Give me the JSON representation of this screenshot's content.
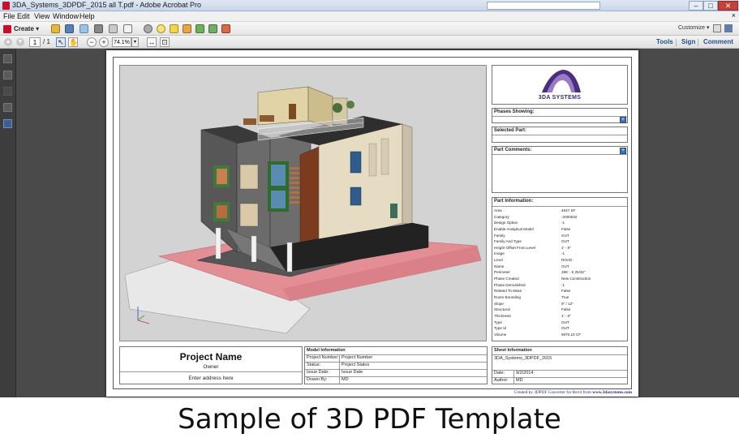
{
  "window": {
    "title": "3DA_Systems_3DPDF_2015 all T.pdf - Adobe Acrobat Pro",
    "buttons": {
      "minimize": "–",
      "maximize": "□",
      "close": "✕"
    }
  },
  "menu": {
    "items": [
      "File",
      "Edit",
      "View",
      "Window",
      "Help"
    ],
    "close_doc": "×"
  },
  "toolbar": {
    "create_label": "Create",
    "customize_label": "Customize"
  },
  "navigation": {
    "current_page": "1",
    "total_pages": "/ 1",
    "zoom": "74.1%",
    "panes": [
      "Tools",
      "Sign",
      "Comment"
    ]
  },
  "document": {
    "logo_text": "3DA SYSTEMS",
    "phases_label": "Phases Showing:",
    "selected_label": "Selected Part:",
    "comments_label": "Part Comments:",
    "info_label": "Part Information:",
    "part_info": [
      {
        "k": "Area",
        "v": "4647 SF"
      },
      {
        "k": "Category",
        "v": "-2000032"
      },
      {
        "k": "Design Option",
        "v": "-1"
      },
      {
        "k": "Enable Analytical Model",
        "v": "False"
      },
      {
        "k": "Family",
        "v": "OUT"
      },
      {
        "k": "Family And Type",
        "v": "OUT"
      },
      {
        "k": "Height Offset From Level",
        "v": "1' - 8\""
      },
      {
        "k": "Image",
        "v": "-1"
      },
      {
        "k": "Level",
        "v": "ROAD"
      },
      {
        "k": "Name",
        "v": "OUT"
      },
      {
        "k": "Perimeter",
        "v": "286' - 5 25/32\""
      },
      {
        "k": "Phase Created",
        "v": "New Construction"
      },
      {
        "k": "Phase Demolished",
        "v": "-1"
      },
      {
        "k": "Related To Mass",
        "v": "False"
      },
      {
        "k": "Room Bounding",
        "v": "True"
      },
      {
        "k": "Slope",
        "v": "0\" / 12\""
      },
      {
        "k": "Structural",
        "v": "False"
      },
      {
        "k": "Thickness",
        "v": "1' - 8\""
      },
      {
        "k": "Type",
        "v": "OUT"
      },
      {
        "k": "Type Id",
        "v": "OUT"
      },
      {
        "k": "Volume",
        "v": "6970.10 CF"
      }
    ],
    "project_name": "Project Name",
    "owner": "Owner",
    "address": "Enter address here",
    "model_info": {
      "header": "Model Information",
      "rows": [
        {
          "k": "Project Number:",
          "v": "Project Number"
        },
        {
          "k": "Status:",
          "v": "Project Status"
        },
        {
          "k": "Issue Date:",
          "v": "Issue Date"
        },
        {
          "k": "Drawn By:",
          "v": "MD"
        }
      ]
    },
    "sheet_info": {
      "header": "Sheet Information",
      "name": "3DA_Systems_3DPDF_2015",
      "date_label": "Date:",
      "date_value": "9/2/2014",
      "author_label": "Author:",
      "author_value": "MD"
    },
    "credit_prefix": "Created by 3DPDF Converter for Revit from ",
    "credit_link": "www.3dasystems.com"
  },
  "caption": "Sample of 3D PDF Template"
}
